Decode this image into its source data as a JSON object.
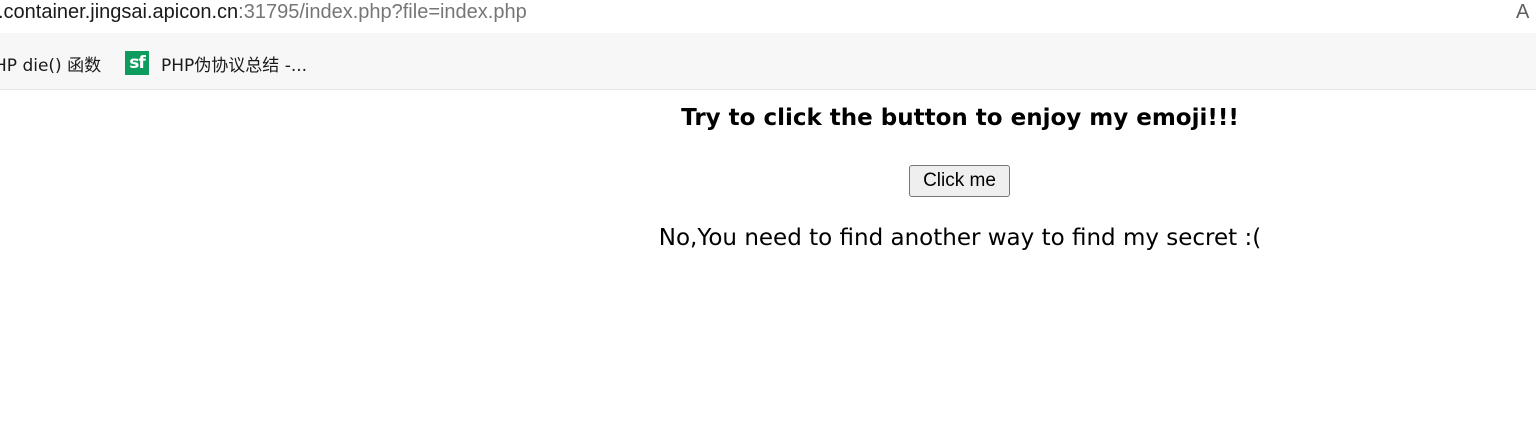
{
  "browser": {
    "url_host": ".container.jingsai.apicon.cn",
    "url_rest": ":31795/index.php?file=index.php",
    "reader_icon": "reader-mode-icon"
  },
  "bookmarks": {
    "items": [
      {
        "label": "HP die() 函数"
      },
      {
        "icon_text": "sf",
        "label": "PHP伪协议总结 -..."
      }
    ]
  },
  "page": {
    "heading": "Try to click the button to enjoy my emoji!!!",
    "button_label": "Click me",
    "message": "No,You need to find another way to find my secret :("
  },
  "colors": {
    "sf_icon_bg": "#0d9c5e",
    "bookmarks_bar_bg": "#f7f7f7",
    "button_bg": "#efefef"
  }
}
